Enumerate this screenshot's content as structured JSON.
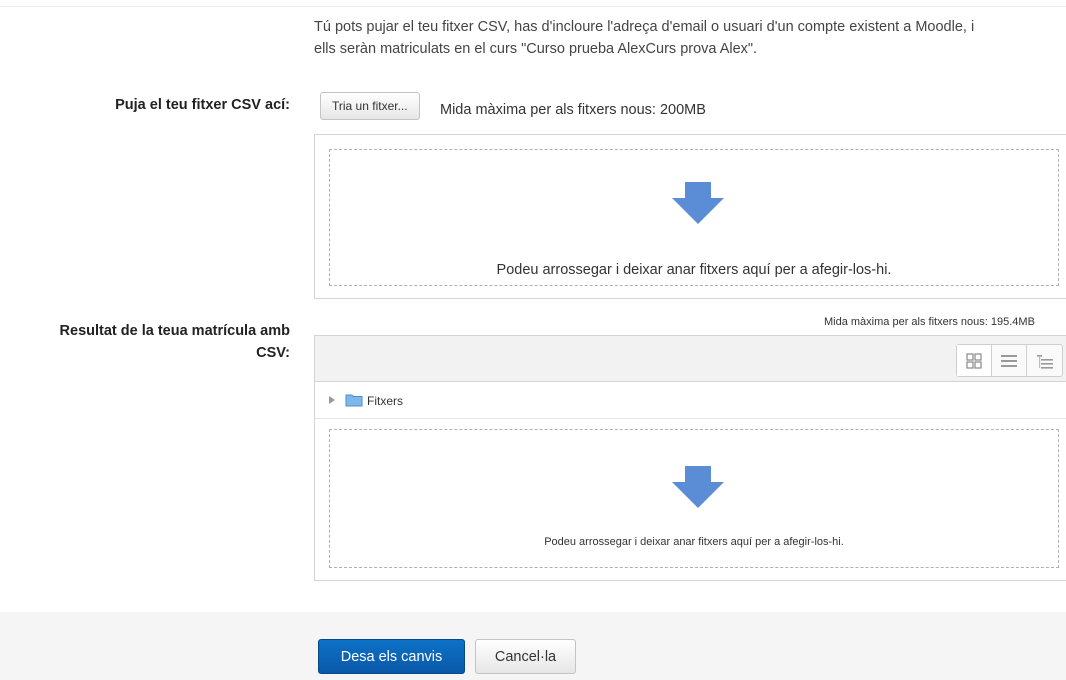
{
  "intro": {
    "line1": "Tú pots pujar el teu fitxer CSV, has d'incloure l'adreça d'email o usuari d'un compte existent a Moodle, i",
    "line2": "ells seràn matriculats en el curs \"Curso prueba AlexCurs prova Alex\"."
  },
  "upload": {
    "label": "Puja el teu fitxer CSV ací:",
    "choose_button": "Tria un fitxer...",
    "max_size": "Mida màxima per als fitxers nous: 200MB",
    "drop_text": "Podeu arrossegar i deixar anar fitxers aquí per a afegir-los-hi."
  },
  "result": {
    "label_line1": "Resultat de la teua matrícula amb",
    "label_line2": "CSV:",
    "max_size": "Mida màxima per als fitxers nous: 195.4MB",
    "folder_name": "Fitxers",
    "drop_text": "Podeu arrossegar i deixar anar fitxers aquí per a afegir-los-hi.",
    "view_buttons": [
      "grid-view-icon",
      "list-view-icon",
      "tree-view-icon"
    ]
  },
  "footer": {
    "save_label": "Desa els canvis",
    "cancel_label": "Cancel·la"
  },
  "colors": {
    "primary": "#0a62b6",
    "arrow": "#5b8cd6",
    "folder": "#7fb7e8"
  }
}
